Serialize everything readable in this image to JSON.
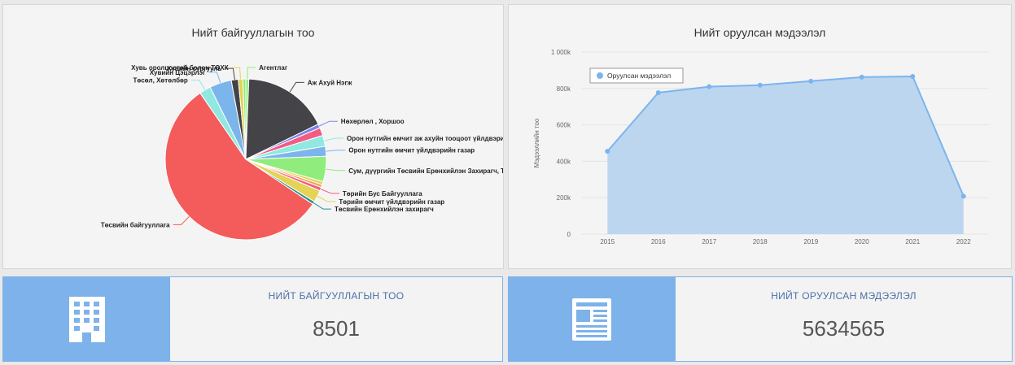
{
  "pie_panel": {
    "title": "Нийт байгууллагын тоо"
  },
  "area_panel": {
    "title": "Нийт оруулсан мэдээлэл"
  },
  "cards": {
    "orgs": {
      "label": "НИЙТ БАЙГУУЛЛАГЫН ТОО",
      "value": "8501",
      "icon": "building-icon"
    },
    "info": {
      "label": "НИЙТ ОРУУЛСАН МЭДЭЭЛЭЛ",
      "value": "5634565",
      "icon": "newspaper-icon"
    }
  },
  "colors": {
    "accent": "#7db2ea",
    "area_fill": "#b6d3f0",
    "area_line": "#7cb5ec"
  },
  "chart_data": [
    {
      "type": "pie",
      "title": "Нийт байгууллагын тоо",
      "slices": [
        {
          "label": "Агентлаг",
          "value": 0.6,
          "color": "#90ed7d"
        },
        {
          "label": "Аж Ахуй Нэгж",
          "value": 17.2,
          "color": "#434348"
        },
        {
          "label": "Нөхөрлөл , Хоршоо",
          "value": 0.8,
          "color": "#8085e9"
        },
        {
          "label": "",
          "value": 1.6,
          "color": "#f15c80"
        },
        {
          "label": "Орон нутгийн өмчит аж ахуйн тооцоот үйлдвэрийн газар",
          "value": 2.2,
          "color": "#91e8e1"
        },
        {
          "label": "Орон нутгийн өмчит үйлдвэрийн газар",
          "value": 2.0,
          "color": "#7cb5ec"
        },
        {
          "label": "Сум, дүүргийн Төсвийн Ерөнхийлэн Захирагч, Төвлөрүүлэн захирагч",
          "value": 5.1,
          "color": "#90ed7d"
        },
        {
          "label": "",
          "value": 0.6,
          "color": "#e4d354"
        },
        {
          "label": "",
          "value": 0.6,
          "color": "#f7a35c"
        },
        {
          "label": "Төрийн Бус Байгууллага",
          "value": 0.7,
          "color": "#f15c80"
        },
        {
          "label": "Төрийн өмчит үйлдвэрийн газар",
          "value": 2.4,
          "color": "#e4d354"
        },
        {
          "label": "Төсвийн Ерөнхийлэн захирагч",
          "value": 0.6,
          "color": "#2b908f"
        },
        {
          "label": "Төсвийн байгууллага",
          "value": 56.0,
          "color": "#f45b5b"
        },
        {
          "label": "Төсөл, Хөтөлбөр",
          "value": 2.3,
          "color": "#91e8e1"
        },
        {
          "label": "Хувийн Цэцэрлэг",
          "value": 4.4,
          "color": "#7cb5ec"
        },
        {
          "label": "Хувийн сургууль",
          "value": 1.4,
          "color": "#434348"
        },
        {
          "label": "Хувь оролцоотой болон ТӨХК",
          "value": 0.9,
          "color": "#e4d354"
        },
        {
          "label": "",
          "value": 0.6,
          "color": "#90ed7d"
        }
      ]
    },
    {
      "type": "area",
      "title": "Нийт оруулсан мэдээлэл",
      "ylabel": "Мэдээллийн тоо",
      "xlabel": "",
      "categories": [
        "2015",
        "2016",
        "2017",
        "2018",
        "2019",
        "2020",
        "2021",
        "2022"
      ],
      "series": [
        {
          "name": "Оруулсан мэдээлэл",
          "values": [
            455000,
            777000,
            810000,
            818000,
            840000,
            862000,
            866000,
            208000
          ]
        }
      ],
      "ylim": [
        0,
        1000000
      ],
      "yticks": [
        "0",
        "200k",
        "400k",
        "600k",
        "800k",
        "1 000k"
      ],
      "grid": true,
      "legend": "top-left"
    }
  ]
}
